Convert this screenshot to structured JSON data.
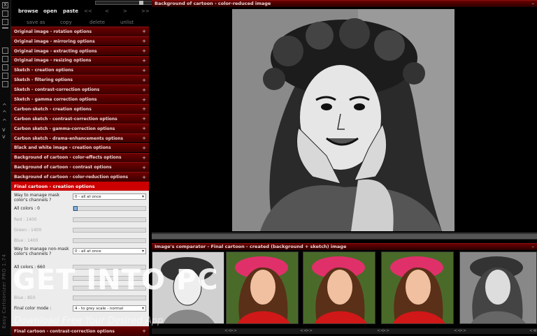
{
  "toolbar": {
    "browse": "browse",
    "open": "open",
    "paste": "paste",
    "nav_first": "<<",
    "nav_prev": "<",
    "nav_next": ">",
    "nav_last": ">>",
    "save_as": "save as",
    "copy": "copy",
    "delete": "delete",
    "unlist": "unlist"
  },
  "rail": {
    "close": "X",
    "arrows": [
      "^",
      "^",
      "v",
      "v"
    ],
    "app_title": "Easy Cartoonizer PRO 1.74"
  },
  "sections": [
    "Original image - rotation options",
    "Original image - mirroring options",
    "Original image - extracting options",
    "Original image - resizing options",
    "Sketch - creation options",
    "Sketch - filtering options",
    "Sketch - contrast-correction options",
    "Sketch - gamma correction options",
    "Carbon-sketch - creation options",
    "Carbon sketch - contrast-correction options",
    "Carbon sketch - gamma-correction options",
    "Carbon sketch - drama-enhancements options",
    "Black and white image - creation options",
    "Background of cartoon - color-effects options",
    "Background of cartoon - contrast options",
    "Background of cartoon - color-reduction options"
  ],
  "active_section": "Final cartoon - creation options",
  "form": {
    "mask_label": "Way to manage mask color's channels ?",
    "mask_value": "0 - all at once",
    "all_colors_label": "All colors : 0",
    "all_colors_value": "0",
    "red_label": "Red : 1400",
    "green_label": "Green : 1400",
    "blue_label": "Blue : 1400",
    "nonmask_label": "Way to manage non-mask color's channels ?",
    "nonmask_value": "0 - all at once",
    "all_colors2_label": "All colors : 660",
    "blue2_label": "Blue : 850",
    "final_label": "Final color mode :",
    "final_value": "4 - to grey scale - normal"
  },
  "bottom_section": "Final cartoon - contrast-correction options",
  "main_panel_title": "Background of cartoon - color-reduced image",
  "comparator_title": "Image's comparator - Final cartoon - created (background + sketch) image",
  "thumb_nav": [
    "<<",
    ">>",
    "<<",
    ">>",
    "<<",
    ">>",
    "<<",
    ">>",
    "<<",
    ">>"
  ],
  "watermark": {
    "line1": "GET INTO PC",
    "line2": "Download Free Your Desired App"
  },
  "colors": {
    "accent": "#cc0000",
    "section": "#5a0000"
  }
}
